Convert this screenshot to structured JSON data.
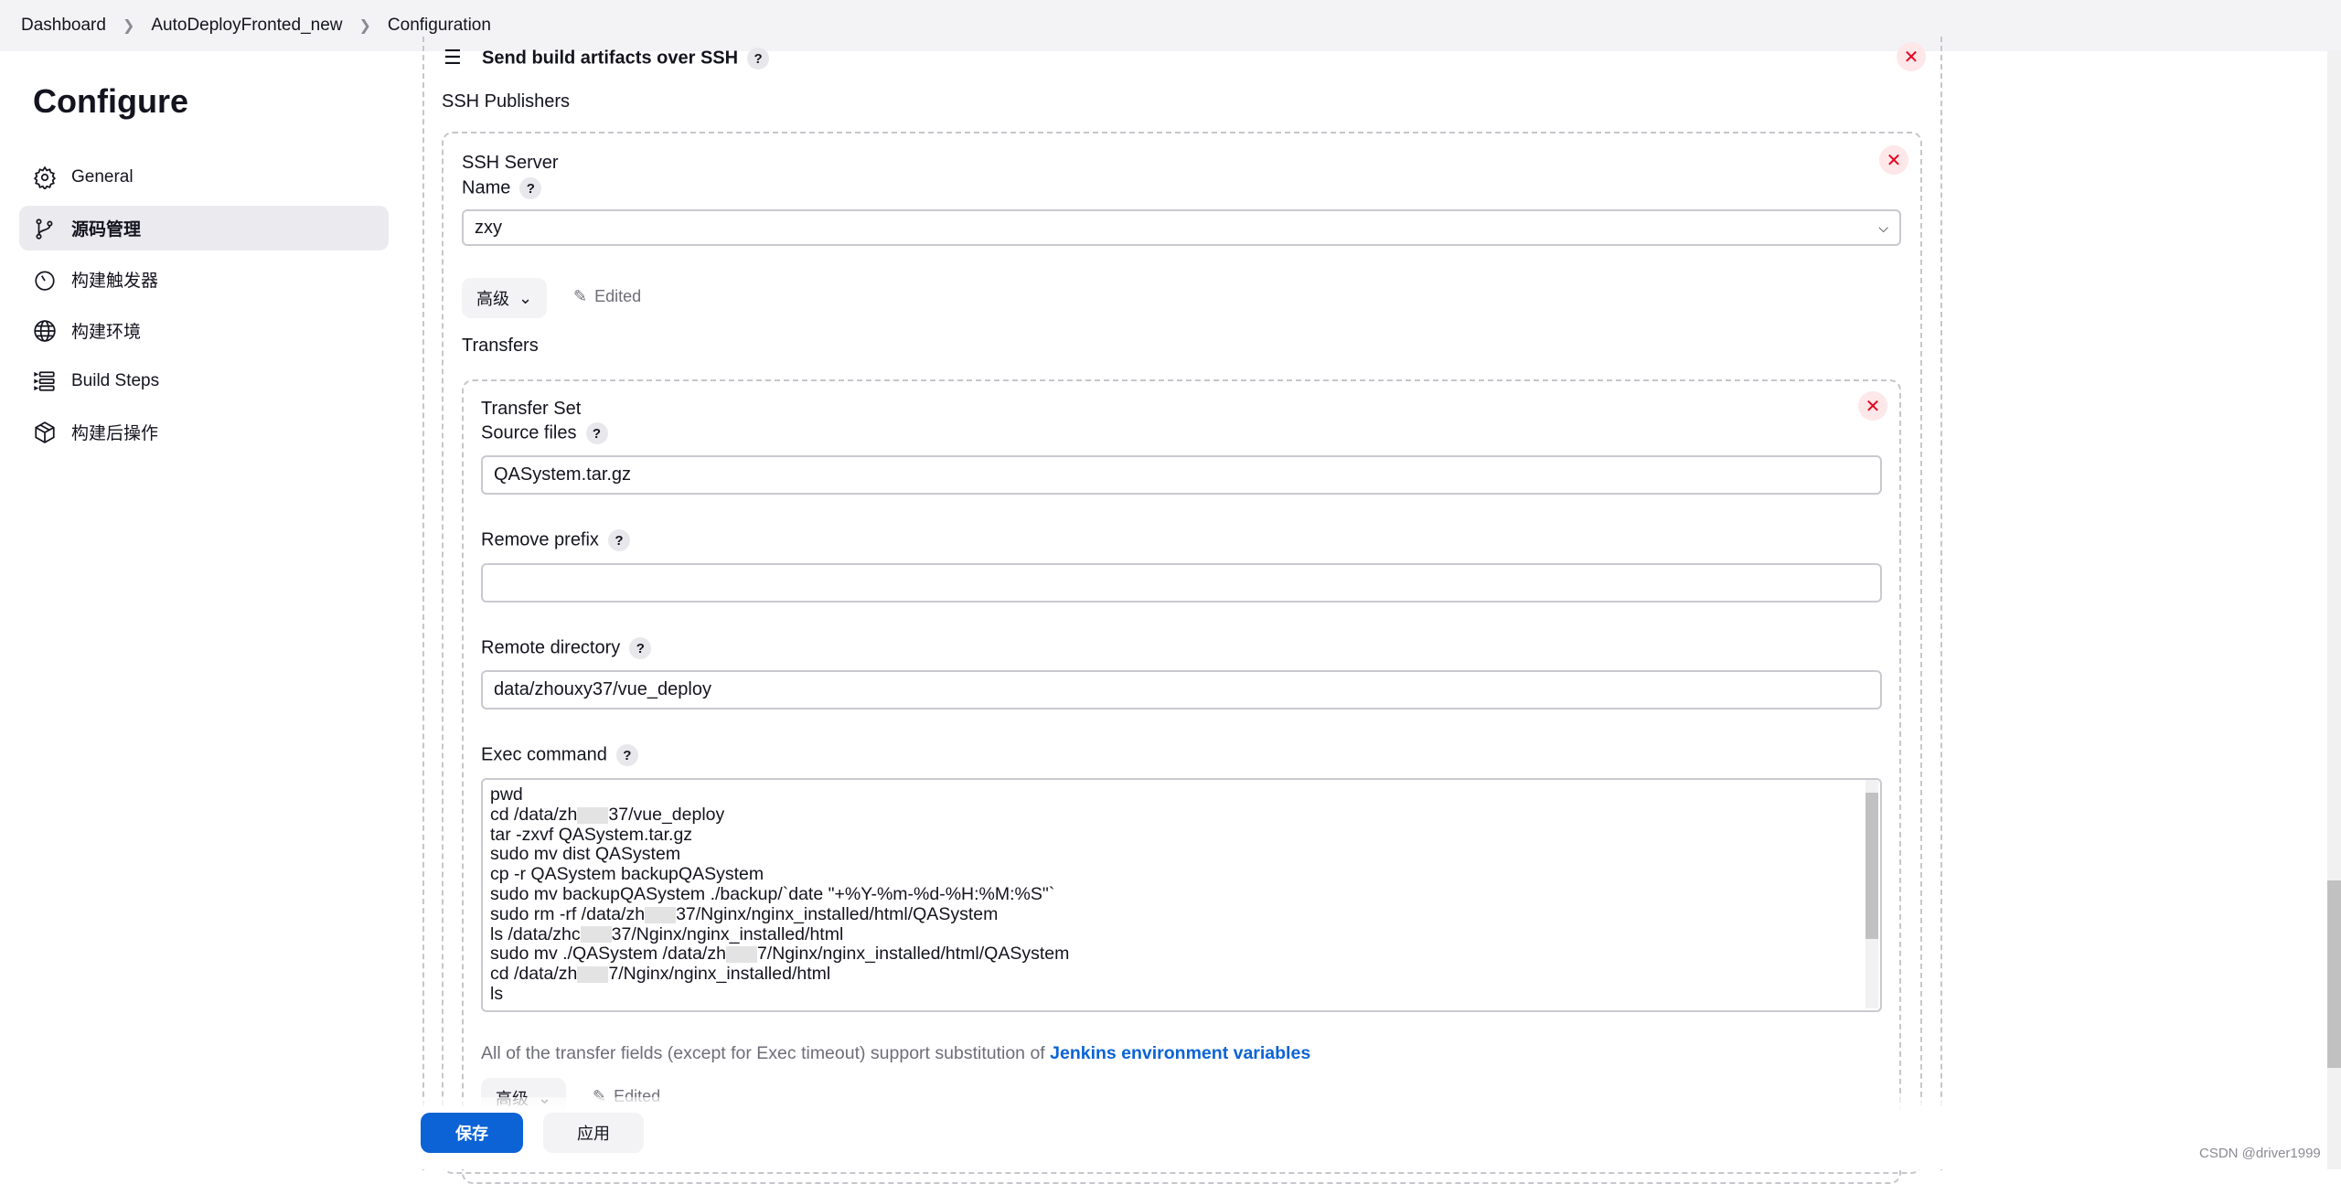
{
  "breadcrumb": [
    "Dashboard",
    "AutoDeployFronted_new",
    "Configuration"
  ],
  "page_title": "Configure",
  "sidebar": {
    "items": [
      {
        "label": "General",
        "icon": "gear-icon"
      },
      {
        "label": "源码管理",
        "icon": "branch-icon",
        "active": true
      },
      {
        "label": "构建触发器",
        "icon": "timer-icon"
      },
      {
        "label": "构建环境",
        "icon": "globe-icon"
      },
      {
        "label": "Build Steps",
        "icon": "list-icon"
      },
      {
        "label": "构建后操作",
        "icon": "package-icon"
      }
    ]
  },
  "section": {
    "title": "Send build artifacts over SSH",
    "help": "?",
    "publishers_label": "SSH Publishers"
  },
  "ssh_server": {
    "label": "SSH Server",
    "name_label": "Name",
    "name_value": "zxy",
    "advanced_label": "高级",
    "edited_label": "Edited",
    "transfers_label": "Transfers"
  },
  "transfer_set": {
    "label": "Transfer Set",
    "source_files_label": "Source files",
    "source_files_value": "QASystem.tar.gz",
    "remove_prefix_label": "Remove prefix",
    "remove_prefix_value": "",
    "remote_directory_label": "Remote directory",
    "remote_directory_value": "data/zhouxy37/vue_deploy",
    "exec_command_label": "Exec command",
    "exec_command_lines": [
      [
        "pwd"
      ],
      [
        "cd /data/zh",
        "37/vue_deploy"
      ],
      [
        "tar -zxvf  QASystem.tar.gz"
      ],
      [
        "sudo mv dist QASystem"
      ],
      [
        "cp -r QASystem backupQASystem"
      ],
      [
        "sudo mv backupQASystem ./backup/`date \"+%Y-%m-%d-%H:%M:%S\"`"
      ],
      [
        "sudo rm -rf  /data/zh",
        "37/Nginx/nginx_installed/html/QASystem"
      ],
      [
        "ls /data/zhc",
        "37/Nginx/nginx_installed/html"
      ],
      [
        "sudo mv ./QASystem /data/zh",
        "7/Nginx/nginx_installed/html/QASystem"
      ],
      [
        "cd /data/zh",
        "7/Nginx/nginx_installed/html"
      ],
      [
        "ls"
      ]
    ],
    "help_text": "All of the transfer fields (except for Exec timeout) support substitution of ",
    "help_link": "Jenkins environment variables",
    "advanced_label": "高级",
    "edited_label": "Edited"
  },
  "footer": {
    "save": "保存",
    "apply": "应用"
  },
  "watermark": "CSDN @driver1999",
  "colors": {
    "primary": "#0b63d6",
    "danger": "#e6001f"
  }
}
